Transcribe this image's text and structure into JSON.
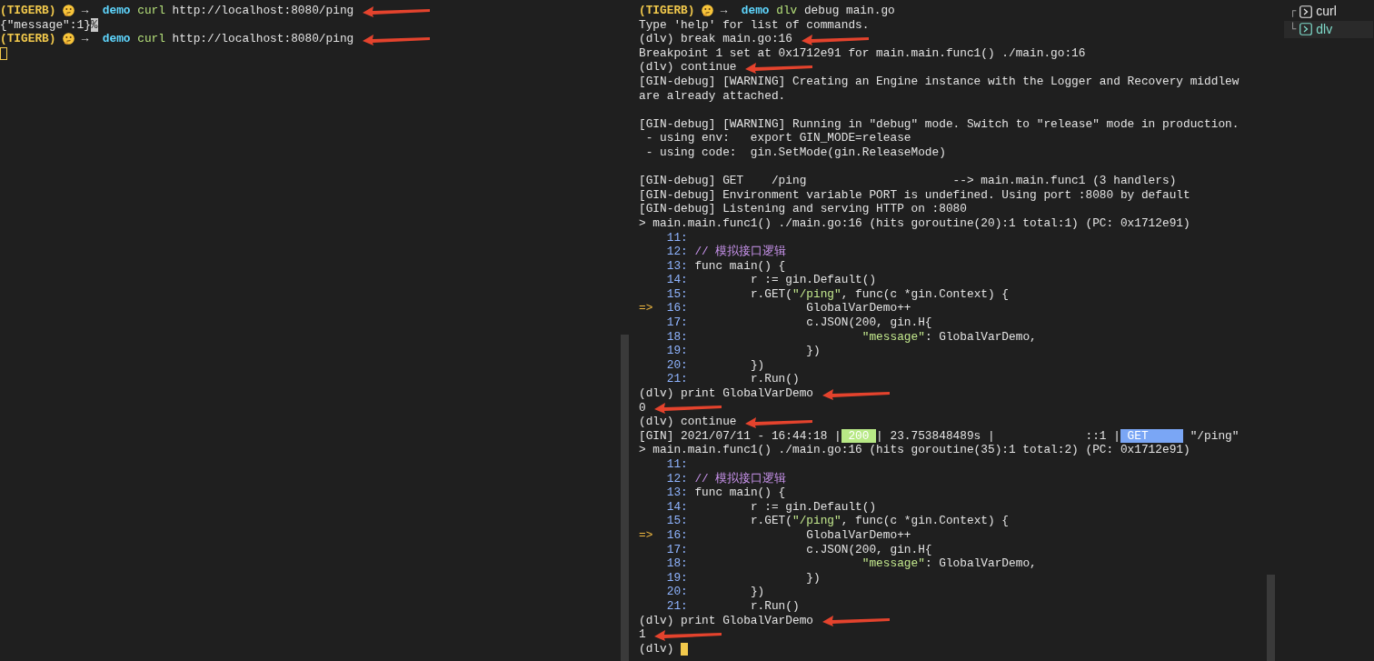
{
  "left_pane": {
    "focused": false,
    "lines": [
      {
        "annotated": true,
        "segments": [
          {
            "kind": "prompt",
            "text": "(TIGERB)"
          },
          {
            "kind": "emoji"
          },
          {
            "kind": "arrow",
            "text": "→"
          },
          {
            "kind": "dir",
            "text": "demo"
          },
          {
            "kind": "cmd",
            "text": "curl"
          },
          {
            "kind": "plain",
            "text": " http://localhost:8080/ping"
          }
        ]
      },
      {
        "segments": [
          {
            "kind": "plain",
            "text": "{\"message\":1}"
          },
          {
            "kind": "eol",
            "text": "%"
          }
        ]
      },
      {
        "annotated": true,
        "segments": [
          {
            "kind": "prompt",
            "text": "(TIGERB)"
          },
          {
            "kind": "emoji"
          },
          {
            "kind": "arrow",
            "text": "→"
          },
          {
            "kind": "dir",
            "text": "demo"
          },
          {
            "kind": "cmd",
            "text": "curl"
          },
          {
            "kind": "plain",
            "text": " http://localhost:8080/ping"
          }
        ]
      },
      {
        "segments": [
          {
            "kind": "cursor"
          }
        ]
      }
    ]
  },
  "right_pane": {
    "focused": true,
    "lines": [
      {
        "segments": [
          {
            "kind": "prompt",
            "text": "(TIGERB)"
          },
          {
            "kind": "emoji"
          },
          {
            "kind": "arrow",
            "text": "→"
          },
          {
            "kind": "dir",
            "text": "demo"
          },
          {
            "kind": "cmd",
            "text": "dlv"
          },
          {
            "kind": "plain",
            "text": " debug main.go"
          }
        ]
      },
      {
        "segments": [
          {
            "kind": "plain",
            "text": "Type 'help' for list of commands."
          }
        ]
      },
      {
        "annotated": true,
        "segments": [
          {
            "kind": "plain",
            "text": "(dlv) break main.go:16"
          }
        ]
      },
      {
        "segments": [
          {
            "kind": "plain",
            "text": "Breakpoint 1 set at 0x1712e91 for main.main.func1() ./main.go:16"
          }
        ]
      },
      {
        "annotated": true,
        "segments": [
          {
            "kind": "plain",
            "text": "(dlv) continue"
          }
        ]
      },
      {
        "segments": [
          {
            "kind": "plain",
            "text": "[GIN-debug] [WARNING] Creating an Engine instance with the Logger and Recovery middlew"
          }
        ]
      },
      {
        "segments": [
          {
            "kind": "plain",
            "text": "are already attached."
          }
        ]
      },
      {
        "blank": true
      },
      {
        "segments": [
          {
            "kind": "plain",
            "text": "[GIN-debug] [WARNING] Running in \"debug\" mode. Switch to \"release\" mode in production."
          }
        ]
      },
      {
        "segments": [
          {
            "kind": "plain",
            "text": " - using env:   export GIN_MODE=release"
          }
        ]
      },
      {
        "segments": [
          {
            "kind": "plain",
            "text": " - using code:  gin.SetMode(gin.ReleaseMode)"
          }
        ]
      },
      {
        "blank": true
      },
      {
        "segments": [
          {
            "kind": "plain",
            "text": "[GIN-debug] GET    /ping                     --> main.main.func1 (3 handlers)"
          }
        ]
      },
      {
        "segments": [
          {
            "kind": "plain",
            "text": "[GIN-debug] Environment variable PORT is undefined. Using port :8080 by default"
          }
        ]
      },
      {
        "segments": [
          {
            "kind": "plain",
            "text": "[GIN-debug] Listening and serving HTTP on :8080"
          }
        ]
      },
      {
        "segments": [
          {
            "kind": "plain",
            "text": "> main.main.func1() ./main.go:16 (hits goroutine(20):1 total:1) (PC: 0x1712e91)"
          }
        ]
      },
      {
        "segments": [
          {
            "kind": "linenum",
            "text": "    11:"
          }
        ]
      },
      {
        "segments": [
          {
            "kind": "linenum",
            "text": "    12:"
          },
          {
            "kind": "comment",
            "text": " // 模拟接口逻辑"
          }
        ]
      },
      {
        "segments": [
          {
            "kind": "linenum",
            "text": "    13:"
          },
          {
            "kind": "plain",
            "text": " func main() {"
          }
        ]
      },
      {
        "segments": [
          {
            "kind": "linenum",
            "text": "    14:"
          },
          {
            "kind": "plain",
            "text": "         r := gin.Default()"
          }
        ]
      },
      {
        "segments": [
          {
            "kind": "linenum",
            "text": "    15:"
          },
          {
            "kind": "plain",
            "text": "         r.GET("
          },
          {
            "kind": "string",
            "text": "\"/ping\""
          },
          {
            "kind": "plain",
            "text": ", func(c *gin.Context) {"
          }
        ]
      },
      {
        "segments": [
          {
            "kind": "pointer",
            "text": "=>"
          },
          {
            "kind": "linenum",
            "text": "  16:"
          },
          {
            "kind": "plain",
            "text": "                 GlobalVarDemo++"
          }
        ]
      },
      {
        "segments": [
          {
            "kind": "linenum",
            "text": "    17:"
          },
          {
            "kind": "plain",
            "text": "                 c.JSON(200, gin.H{"
          }
        ]
      },
      {
        "segments": [
          {
            "kind": "linenum",
            "text": "    18:"
          },
          {
            "kind": "string",
            "text": "                         \"message\""
          },
          {
            "kind": "plain",
            "text": ": GlobalVarDemo,"
          }
        ]
      },
      {
        "segments": [
          {
            "kind": "linenum",
            "text": "    19:"
          },
          {
            "kind": "plain",
            "text": "                 })"
          }
        ]
      },
      {
        "segments": [
          {
            "kind": "linenum",
            "text": "    20:"
          },
          {
            "kind": "plain",
            "text": "         })"
          }
        ]
      },
      {
        "segments": [
          {
            "kind": "linenum",
            "text": "    21:"
          },
          {
            "kind": "plain",
            "text": "         r.Run()"
          }
        ]
      },
      {
        "annotated": true,
        "segments": [
          {
            "kind": "plain",
            "text": "(dlv) print GlobalVarDemo"
          }
        ]
      },
      {
        "annotated": true,
        "segments": [
          {
            "kind": "plain",
            "text": "0"
          }
        ]
      },
      {
        "annotated": true,
        "segments": [
          {
            "kind": "plain",
            "text": "(dlv) continue"
          }
        ]
      },
      {
        "segments": [
          {
            "kind": "plain",
            "text": "[GIN] 2021/07/11 - 16:44:18 |"
          },
          {
            "kind": "status",
            "text": " 200 "
          },
          {
            "kind": "plain",
            "text": "| 23.753848489s |             ::1 |"
          },
          {
            "kind": "method",
            "text": " GET     "
          },
          {
            "kind": "plain",
            "text": " \"/ping\""
          }
        ]
      },
      {
        "segments": [
          {
            "kind": "plain",
            "text": "> main.main.func1() ./main.go:16 (hits goroutine(35):1 total:2) (PC: 0x1712e91)"
          }
        ]
      },
      {
        "segments": [
          {
            "kind": "linenum",
            "text": "    11:"
          }
        ]
      },
      {
        "segments": [
          {
            "kind": "linenum",
            "text": "    12:"
          },
          {
            "kind": "comment",
            "text": " // 模拟接口逻辑"
          }
        ]
      },
      {
        "segments": [
          {
            "kind": "linenum",
            "text": "    13:"
          },
          {
            "kind": "plain",
            "text": " func main() {"
          }
        ]
      },
      {
        "segments": [
          {
            "kind": "linenum",
            "text": "    14:"
          },
          {
            "kind": "plain",
            "text": "         r := gin.Default()"
          }
        ]
      },
      {
        "segments": [
          {
            "kind": "linenum",
            "text": "    15:"
          },
          {
            "kind": "plain",
            "text": "         r.GET("
          },
          {
            "kind": "string",
            "text": "\"/ping\""
          },
          {
            "kind": "plain",
            "text": ", func(c *gin.Context) {"
          }
        ]
      },
      {
        "segments": [
          {
            "kind": "pointer",
            "text": "=>"
          },
          {
            "kind": "linenum",
            "text": "  16:"
          },
          {
            "kind": "plain",
            "text": "                 GlobalVarDemo++"
          }
        ]
      },
      {
        "segments": [
          {
            "kind": "linenum",
            "text": "    17:"
          },
          {
            "kind": "plain",
            "text": "                 c.JSON(200, gin.H{"
          }
        ]
      },
      {
        "segments": [
          {
            "kind": "linenum",
            "text": "    18:"
          },
          {
            "kind": "string",
            "text": "                         \"message\""
          },
          {
            "kind": "plain",
            "text": ": GlobalVarDemo,"
          }
        ]
      },
      {
        "segments": [
          {
            "kind": "linenum",
            "text": "    19:"
          },
          {
            "kind": "plain",
            "text": "                 })"
          }
        ]
      },
      {
        "segments": [
          {
            "kind": "linenum",
            "text": "    20:"
          },
          {
            "kind": "plain",
            "text": "         })"
          }
        ]
      },
      {
        "segments": [
          {
            "kind": "linenum",
            "text": "    21:"
          },
          {
            "kind": "plain",
            "text": "         r.Run()"
          }
        ]
      },
      {
        "annotated": true,
        "segments": [
          {
            "kind": "plain",
            "text": "(dlv) print GlobalVarDemo"
          }
        ]
      },
      {
        "annotated": true,
        "segments": [
          {
            "kind": "plain",
            "text": "1"
          }
        ]
      },
      {
        "segments": [
          {
            "kind": "plain",
            "text": "(dlv) "
          },
          {
            "kind": "cursor"
          }
        ]
      }
    ]
  },
  "session_list": [
    {
      "branch": "┌",
      "label": "curl",
      "selected": false
    },
    {
      "branch": "└",
      "label": "dlv",
      "selected": true
    }
  ]
}
